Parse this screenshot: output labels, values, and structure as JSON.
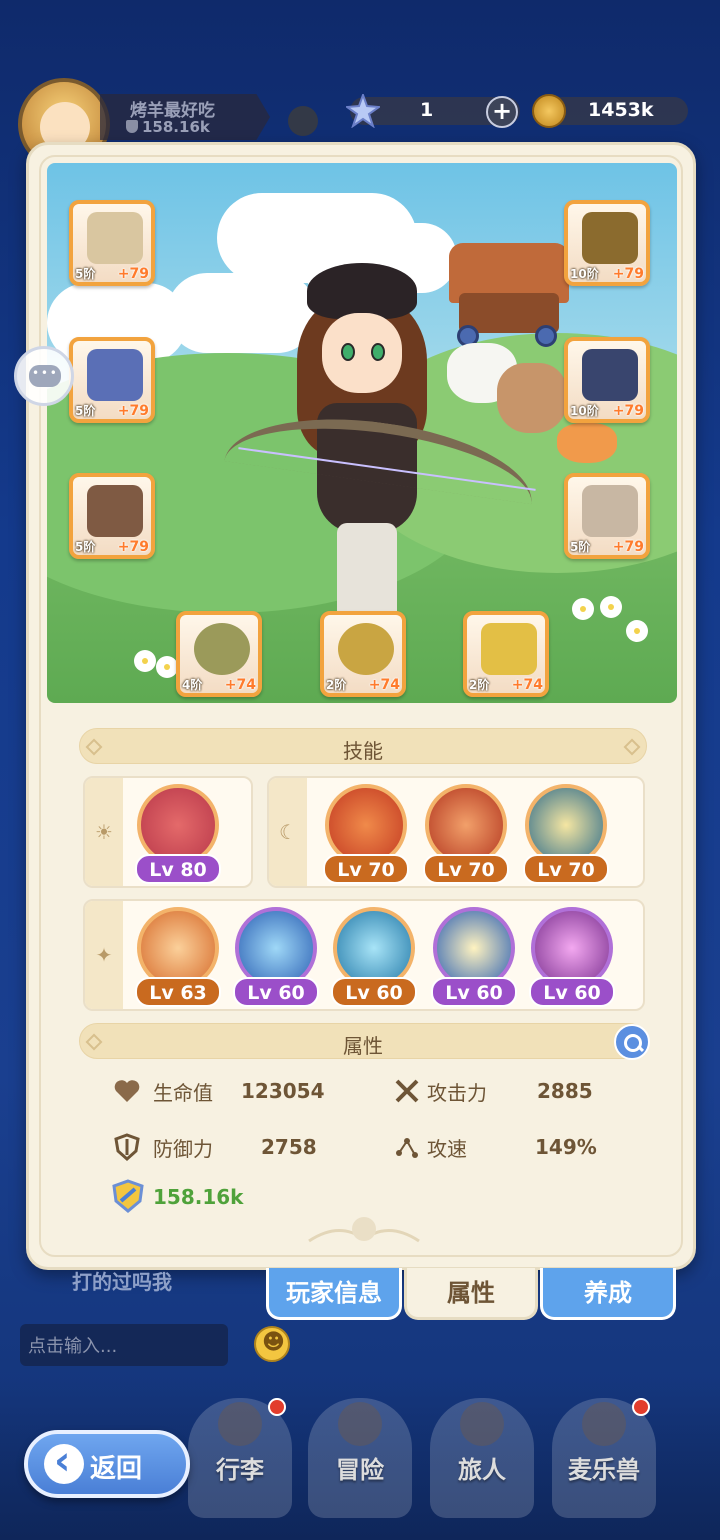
{
  "header": {
    "player_name": "烤羊最好吃",
    "player_power": "158.16k",
    "gems": "1",
    "gold": "1453k"
  },
  "equipment": [
    {
      "slot": "bow",
      "tier": "5阶",
      "plus": "+79",
      "color": "#d9c6a0"
    },
    {
      "slot": "armor",
      "tier": "5阶",
      "plus": "+79",
      "color": "#5a6fb6"
    },
    {
      "slot": "pants",
      "tier": "5阶",
      "plus": "+79",
      "color": "#7f5a43"
    },
    {
      "slot": "helmet",
      "tier": "10阶",
      "plus": "+79",
      "color": "#8b6b2e"
    },
    {
      "slot": "gloves",
      "tier": "10阶",
      "plus": "+79",
      "color": "#39456e"
    },
    {
      "slot": "boots",
      "tier": "5阶",
      "plus": "+79",
      "color": "#c8b7a3"
    },
    {
      "slot": "ring",
      "tier": "4阶",
      "plus": "+74",
      "color": "#9b9a5a"
    },
    {
      "slot": "necklace",
      "tier": "2阶",
      "plus": "+74",
      "color": "#c9a542"
    },
    {
      "slot": "earring",
      "tier": "2阶",
      "plus": "+74",
      "color": "#e3bf45"
    }
  ],
  "skills": {
    "title": "技能",
    "group_sun": [
      {
        "lv": "Lv 80",
        "style": "purple",
        "color": "#b9384a"
      }
    ],
    "group_moon": [
      {
        "lv": "Lv 70",
        "style": "orange",
        "color": "#c33a22"
      },
      {
        "lv": "Lv 70",
        "style": "orange",
        "color": "#b3361f"
      },
      {
        "lv": "Lv 70",
        "style": "orange",
        "color": "#2f6c8a"
      }
    ],
    "group_star": [
      {
        "lv": "Lv 63",
        "style": "orange",
        "color": "#d66a2a"
      },
      {
        "lv": "Lv 60",
        "style": "purple",
        "color": "#2b5fb3"
      },
      {
        "lv": "Lv 60",
        "style": "orange",
        "color": "#2379a8"
      },
      {
        "lv": "Lv 60",
        "style": "purple",
        "color": "#2b5fb3"
      },
      {
        "lv": "Lv 60",
        "style": "purple",
        "color": "#7a2f8f"
      }
    ]
  },
  "attributes": {
    "title": "属性",
    "hp_label": "生命值",
    "hp_value": "123054",
    "atk_label": "攻击力",
    "atk_value": "2885",
    "def_label": "防御力",
    "def_value": "2758",
    "spd_label": "攻速",
    "spd_value": "149%",
    "power_value": "158.16k"
  },
  "tabs": {
    "player_info": "玩家信息",
    "attributes": "属性",
    "develop": "养成"
  },
  "chat": {
    "last_message": "打的过吗我",
    "input_placeholder": "点击输入..."
  },
  "nav": {
    "bag": "行李",
    "adventure": "冒险",
    "travelers": "旅人",
    "beasts": "麦乐兽",
    "back": "返回"
  },
  "colors": {
    "panel_bg": "#f7f1e1",
    "accent_blue": "#5ea3ec",
    "slot_border": "#f2a33e",
    "power_green": "#4fa23a"
  }
}
